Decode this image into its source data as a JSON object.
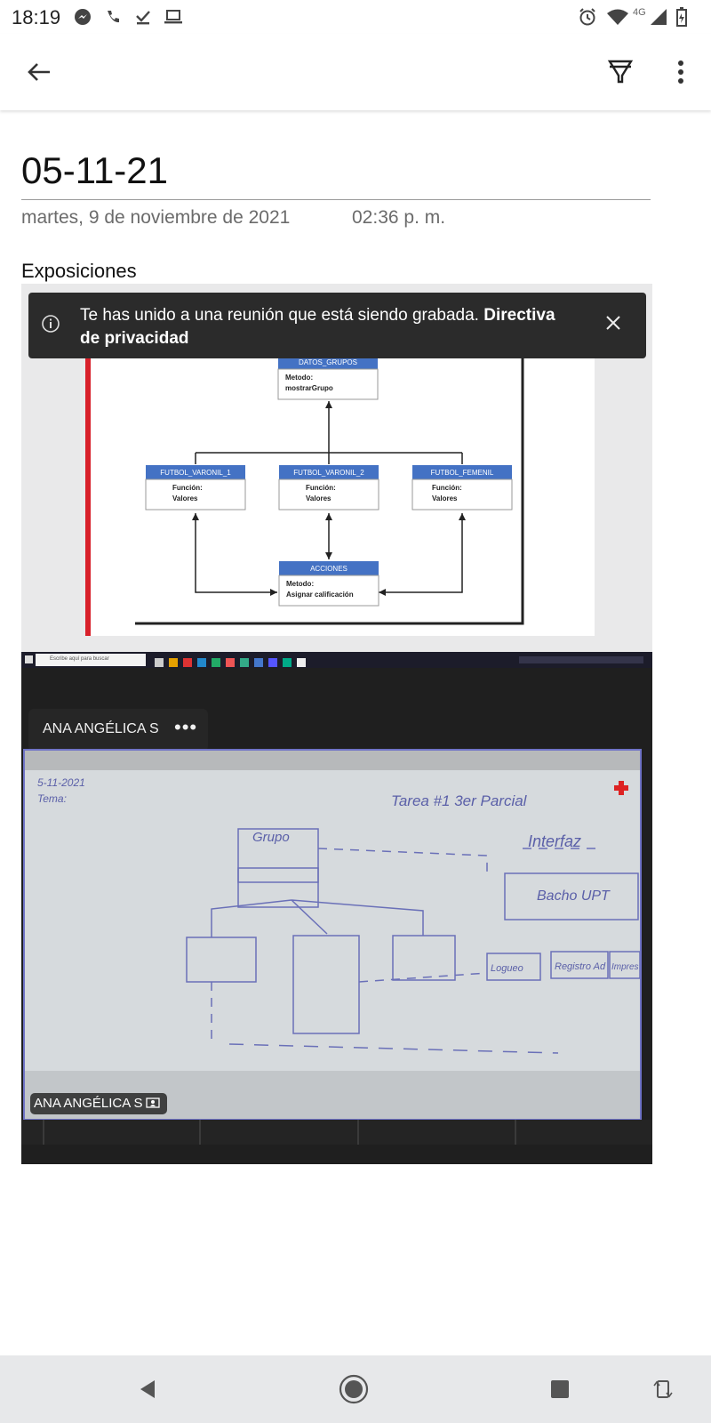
{
  "status_bar": {
    "time": "18:19",
    "network": "4G",
    "left_icons": [
      "messenger-icon",
      "phone-icon",
      "download-done-icon",
      "laptop-icon"
    ],
    "right_icons": [
      "alarm-icon",
      "wifi-icon",
      "signal-icon",
      "battery-icon"
    ]
  },
  "app_bar": {
    "icons": [
      "back-arrow-icon",
      "highlighter-icon",
      "more-vert-icon"
    ]
  },
  "note": {
    "title": "05-11-21",
    "date": "martes, 9 de noviembre de 2021",
    "time": "02:36 p. m.",
    "body": "Exposiciones"
  },
  "attachment": {
    "banner_text": "Te has unido a una reunión que está siendo grabada.",
    "banner_link": "Directiva de privacidad",
    "participant_name": "ANA ANGÉLICA S",
    "participant_more": "•••",
    "video_label": "ANA ANGÉLICA S",
    "taskbar_search": "Escribe aquí para buscar",
    "diagram": {
      "boxes": [
        {
          "title": "DATOS_GRUPOS",
          "line1": "Metodo:",
          "line2": "mostrarGrupo"
        },
        {
          "title": "FUTBOL_VARONIL_1",
          "line1": "Función:",
          "line2": "Valores"
        },
        {
          "title": "FUTBOL_VARONIL_2",
          "line1": "Función:",
          "line2": "Valores"
        },
        {
          "title": "FUTBOL_FEMENIL",
          "line1": "Función:",
          "line2": "Valores"
        },
        {
          "title": "ACCIONES",
          "line1": "Metodo:",
          "line2": "Asignar calificación"
        }
      ]
    },
    "whiteboard": {
      "top_left": "5-11-2021",
      "subject": "Tema:",
      "title": "Tarea #1  3er Parcial",
      "interface": "Interfaz",
      "main_box": "Bacho UPT",
      "class_name": "Grupo",
      "sub_boxes": [
        "Logueo",
        "Registro Ad",
        "Impres"
      ]
    }
  },
  "colors": {
    "header_blue": "#4472c4",
    "banner_bg": "#2b2b2b",
    "video_border": "#6f73c6",
    "nav_bg": "#e7e8ea"
  }
}
